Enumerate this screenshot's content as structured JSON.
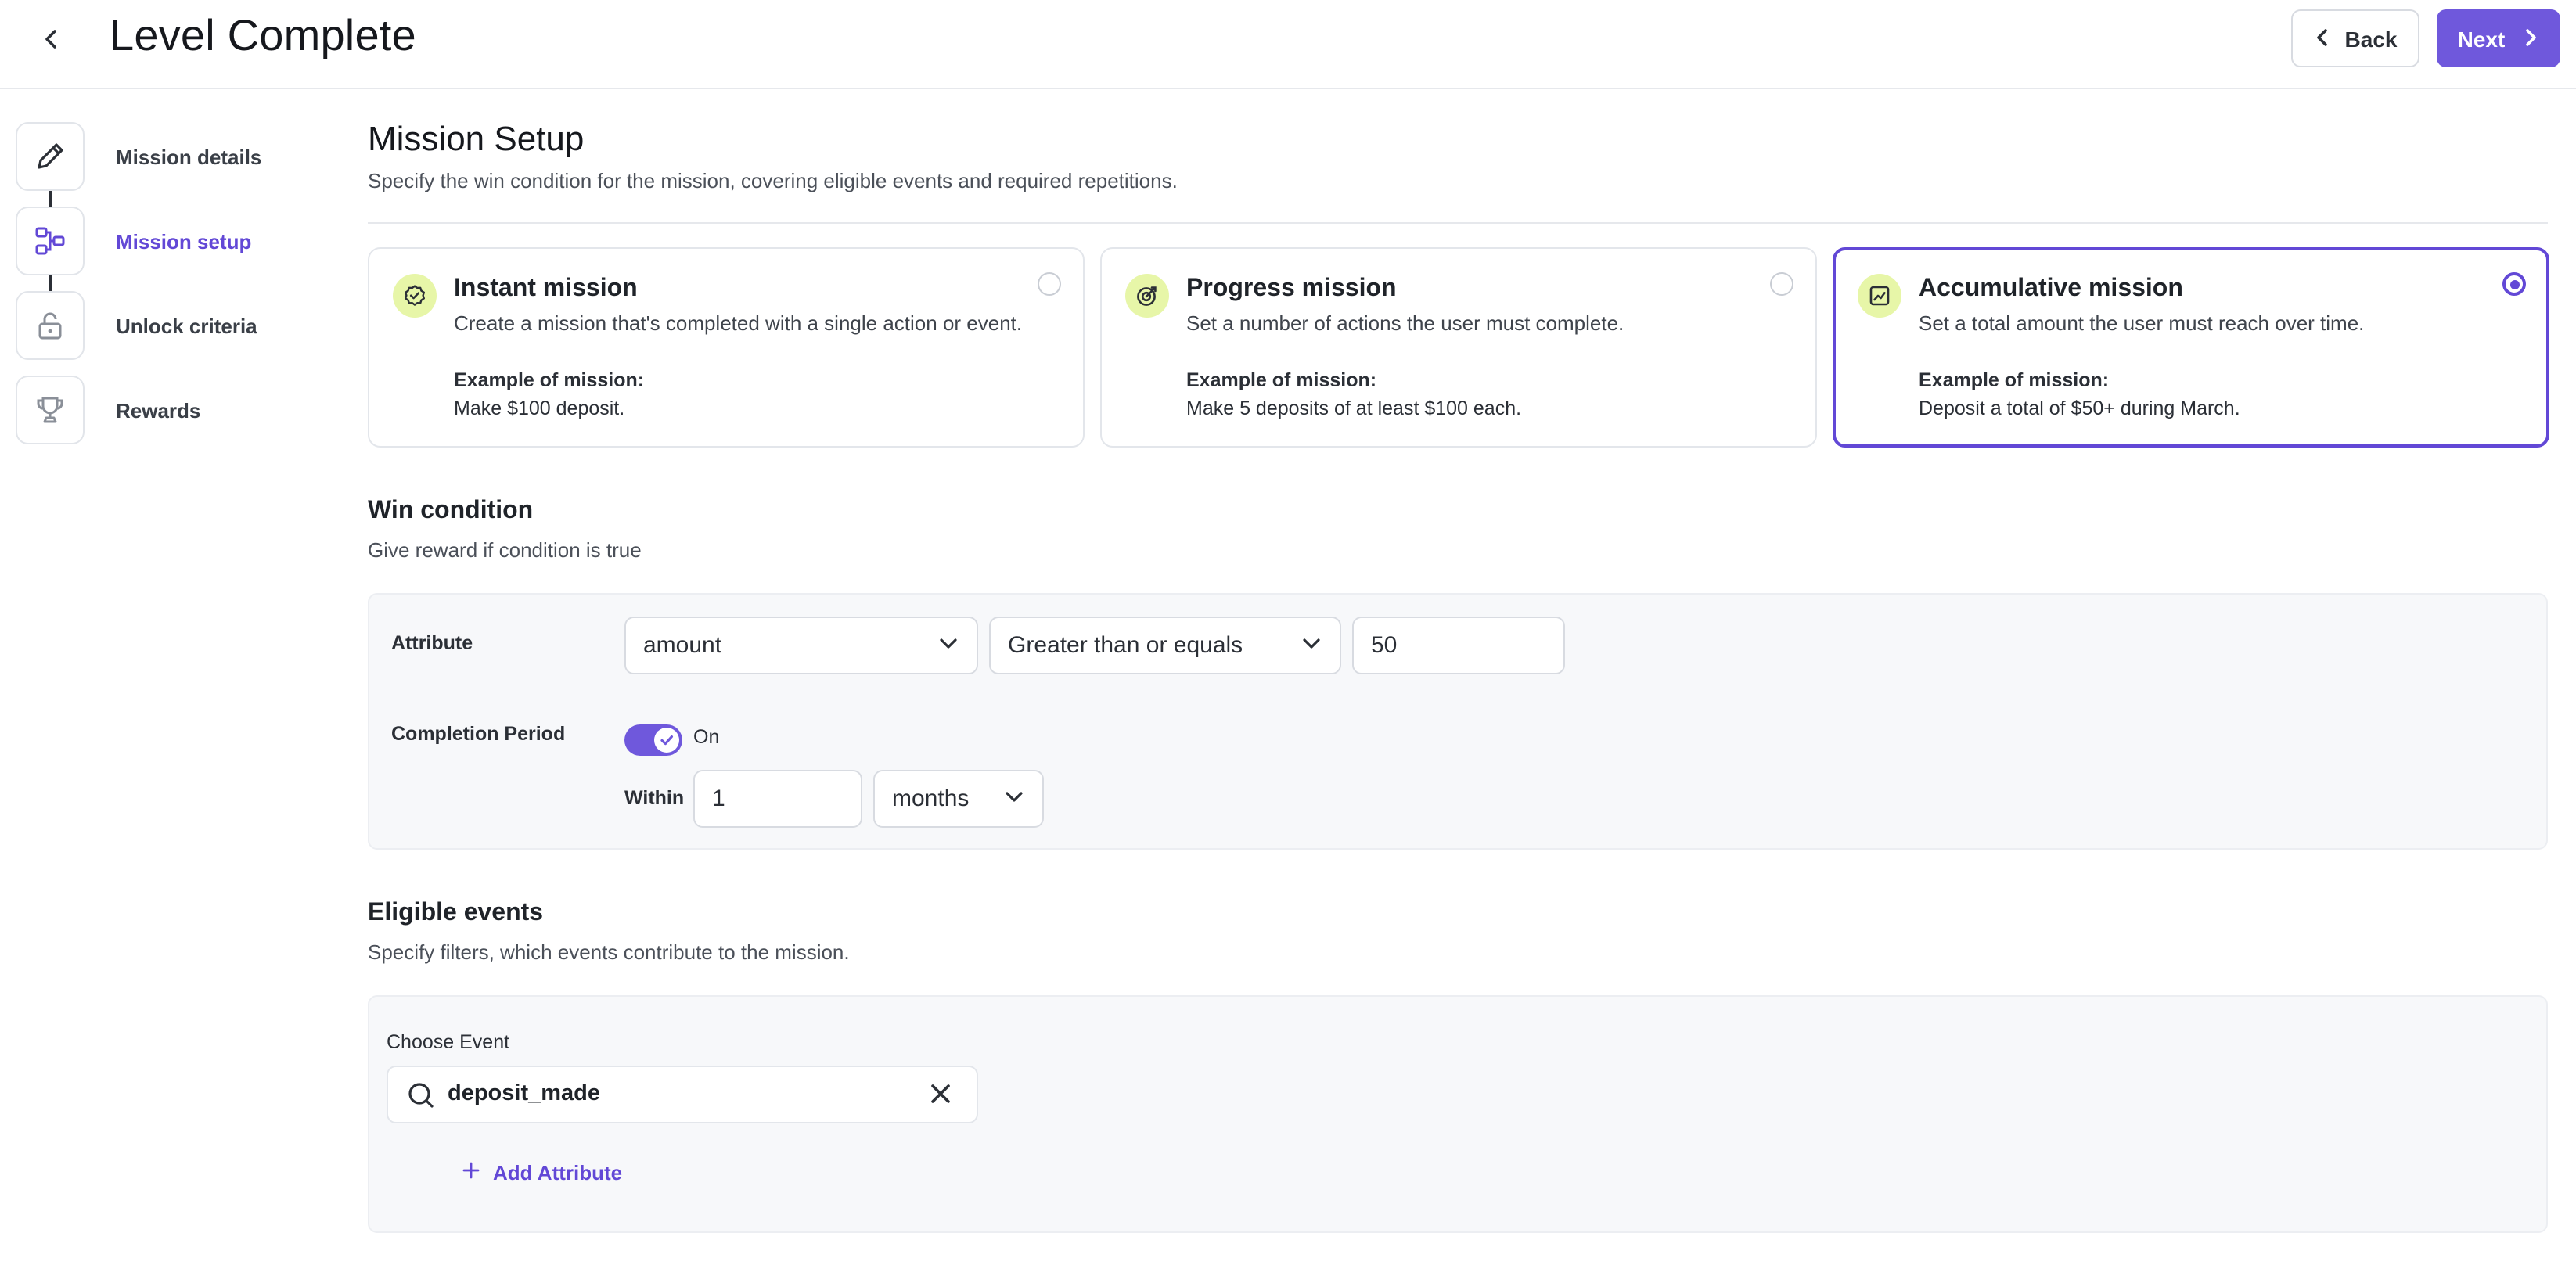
{
  "header": {
    "title": "Level Complete",
    "back_label": "Back",
    "next_label": "Next",
    "back_icon": "chevron-left-icon",
    "next_icon": "chevron-right-icon"
  },
  "steps": [
    {
      "label": "Mission details",
      "icon": "pencil-icon",
      "active": false
    },
    {
      "label": "Mission setup",
      "icon": "flow-icon",
      "active": true
    },
    {
      "label": "Unlock criteria",
      "icon": "lock-icon",
      "active": false
    },
    {
      "label": "Rewards",
      "icon": "trophy-icon",
      "active": false
    }
  ],
  "setup": {
    "title": "Mission Setup",
    "subtitle": "Specify the win condition for the mission, covering eligible events and required repetitions."
  },
  "mission_types": [
    {
      "title": "Instant mission",
      "description": "Create a mission that's completed with a single action or event.",
      "example_label": "Example of mission:",
      "example": "Make $100 deposit.",
      "selected": false,
      "icon": "check-circle-icon"
    },
    {
      "title": "Progress mission",
      "description": "Set a number of actions the user must complete.",
      "example_label": "Example of mission:",
      "example": "Make 5 deposits of at least $100 each.",
      "selected": false,
      "icon": "target-icon"
    },
    {
      "title": "Accumulative mission",
      "description": "Set a total amount the user must reach over time.",
      "example_label": "Example of mission:",
      "example": "Deposit a total of $50+ during March.",
      "selected": true,
      "icon": "chart-icon"
    }
  ],
  "win_condition": {
    "title": "Win condition",
    "subtitle": "Give reward if condition is true",
    "attribute_label": "Attribute",
    "attribute_value": "amount",
    "operator_value": "Greater than or equals",
    "threshold_value": "50",
    "completion_label": "Completion Period",
    "toggle_state": "On",
    "within_label": "Within",
    "within_value": "1",
    "within_unit": "months"
  },
  "eligible_events": {
    "title": "Eligible events",
    "subtitle": "Specify filters, which events contribute to the mission.",
    "choose_label": "Choose Event",
    "event_value": "deposit_made",
    "add_attribute_label": "Add Attribute"
  },
  "colors": {
    "accent": "#6248d6",
    "button_primary": "#6f58dc",
    "icon_badge": "#e7f6a8",
    "panel_bg": "#f7f8fa"
  }
}
